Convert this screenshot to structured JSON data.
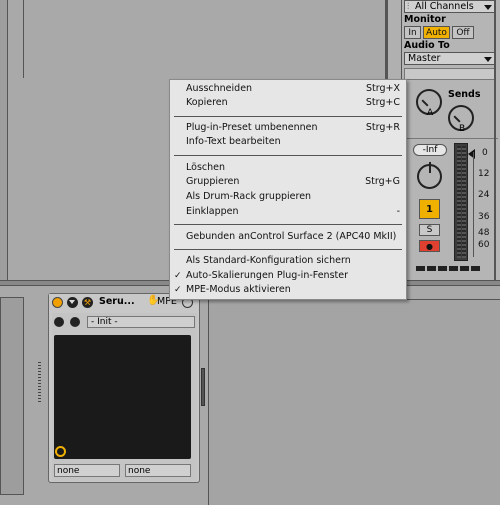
{
  "track": {
    "input_channel": "All Channels",
    "monitor_label": "Monitor",
    "monitor_options": [
      "In",
      "Auto",
      "Off"
    ],
    "audio_to_label": "Audio To",
    "audio_to_value": "Master",
    "sends_label": "Sends",
    "send_a": "A",
    "send_b": "B",
    "volume_display": "-Inf",
    "meter_ticks": [
      "0",
      "12",
      "24",
      "36",
      "48",
      "60"
    ],
    "track_number": "1",
    "solo": "S",
    "arm": "●"
  },
  "context_menu": {
    "items": [
      {
        "label": "Ausschneiden",
        "shortcut": "Strg+X"
      },
      {
        "label": "Kopieren",
        "shortcut": "Strg+C"
      },
      {
        "label": "Plug-in-Preset umbenennen",
        "shortcut": "Strg+R"
      },
      {
        "label": "Info-Text bearbeiten",
        "shortcut": ""
      },
      {
        "label": "Löschen",
        "shortcut": ""
      },
      {
        "label": "Gruppieren",
        "shortcut": "Strg+G"
      },
      {
        "label": "Als Drum-Rack gruppieren",
        "shortcut": ""
      },
      {
        "label": "Einklappen",
        "shortcut": "-"
      },
      {
        "label": "Gebunden anControl Surface 2 (APC40 MkII)",
        "shortcut": ""
      },
      {
        "label": "Als Standard-Konfiguration sichern",
        "shortcut": ""
      },
      {
        "label": "Auto-Skalierungen Plug-in-Fenster",
        "shortcut": "",
        "checked": true
      },
      {
        "label": "MPE-Modus aktivieren",
        "shortcut": "",
        "checked": true
      }
    ]
  },
  "device": {
    "title": "Seru...",
    "mpe_label": "MPE",
    "preset": "- Init -",
    "param_left": "none",
    "param_right": "none"
  }
}
